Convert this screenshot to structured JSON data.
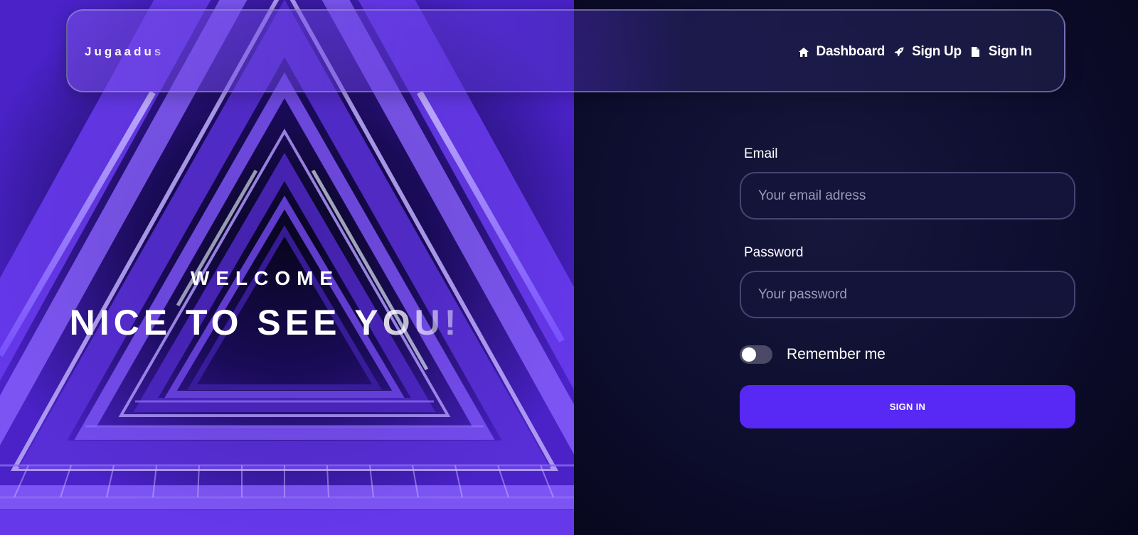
{
  "brand": {
    "name": "Jugaadus"
  },
  "nav": {
    "items": [
      {
        "label": "Dashboard",
        "icon": "home-icon"
      },
      {
        "label": "Sign Up",
        "icon": "rocket-icon"
      },
      {
        "label": "Sign In",
        "icon": "document-icon"
      }
    ]
  },
  "hero": {
    "welcome": "WELCOME",
    "headline": "NICE TO SEE YOU!"
  },
  "form": {
    "email_label": "Email",
    "email_placeholder": "Your email adress",
    "password_label": "Password",
    "password_placeholder": "Your password",
    "remember_label": "Remember me",
    "remember_checked": false,
    "submit_label": "SIGN IN"
  },
  "colors": {
    "accent": "#5828f5",
    "background": "#0a0a26",
    "input_bg": "#14143a"
  }
}
